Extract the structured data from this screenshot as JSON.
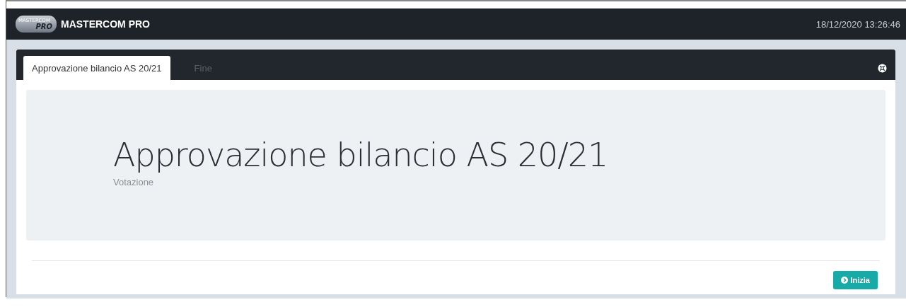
{
  "header": {
    "logo_top": "MASTERCOM",
    "logo_bottom": "PRO",
    "title": "MASTERCOM PRO",
    "datetime": "18/12/2020 13:26:46"
  },
  "tabs": [
    {
      "label": "Approvazione bilancio AS 20/21",
      "selected": true
    },
    {
      "label": "Fine",
      "selected": false
    }
  ],
  "hero": {
    "title": "Approvazione bilancio AS 20/21",
    "subtitle": "Votazione"
  },
  "buttons": [
    {
      "label": "Inizia"
    }
  ]
}
